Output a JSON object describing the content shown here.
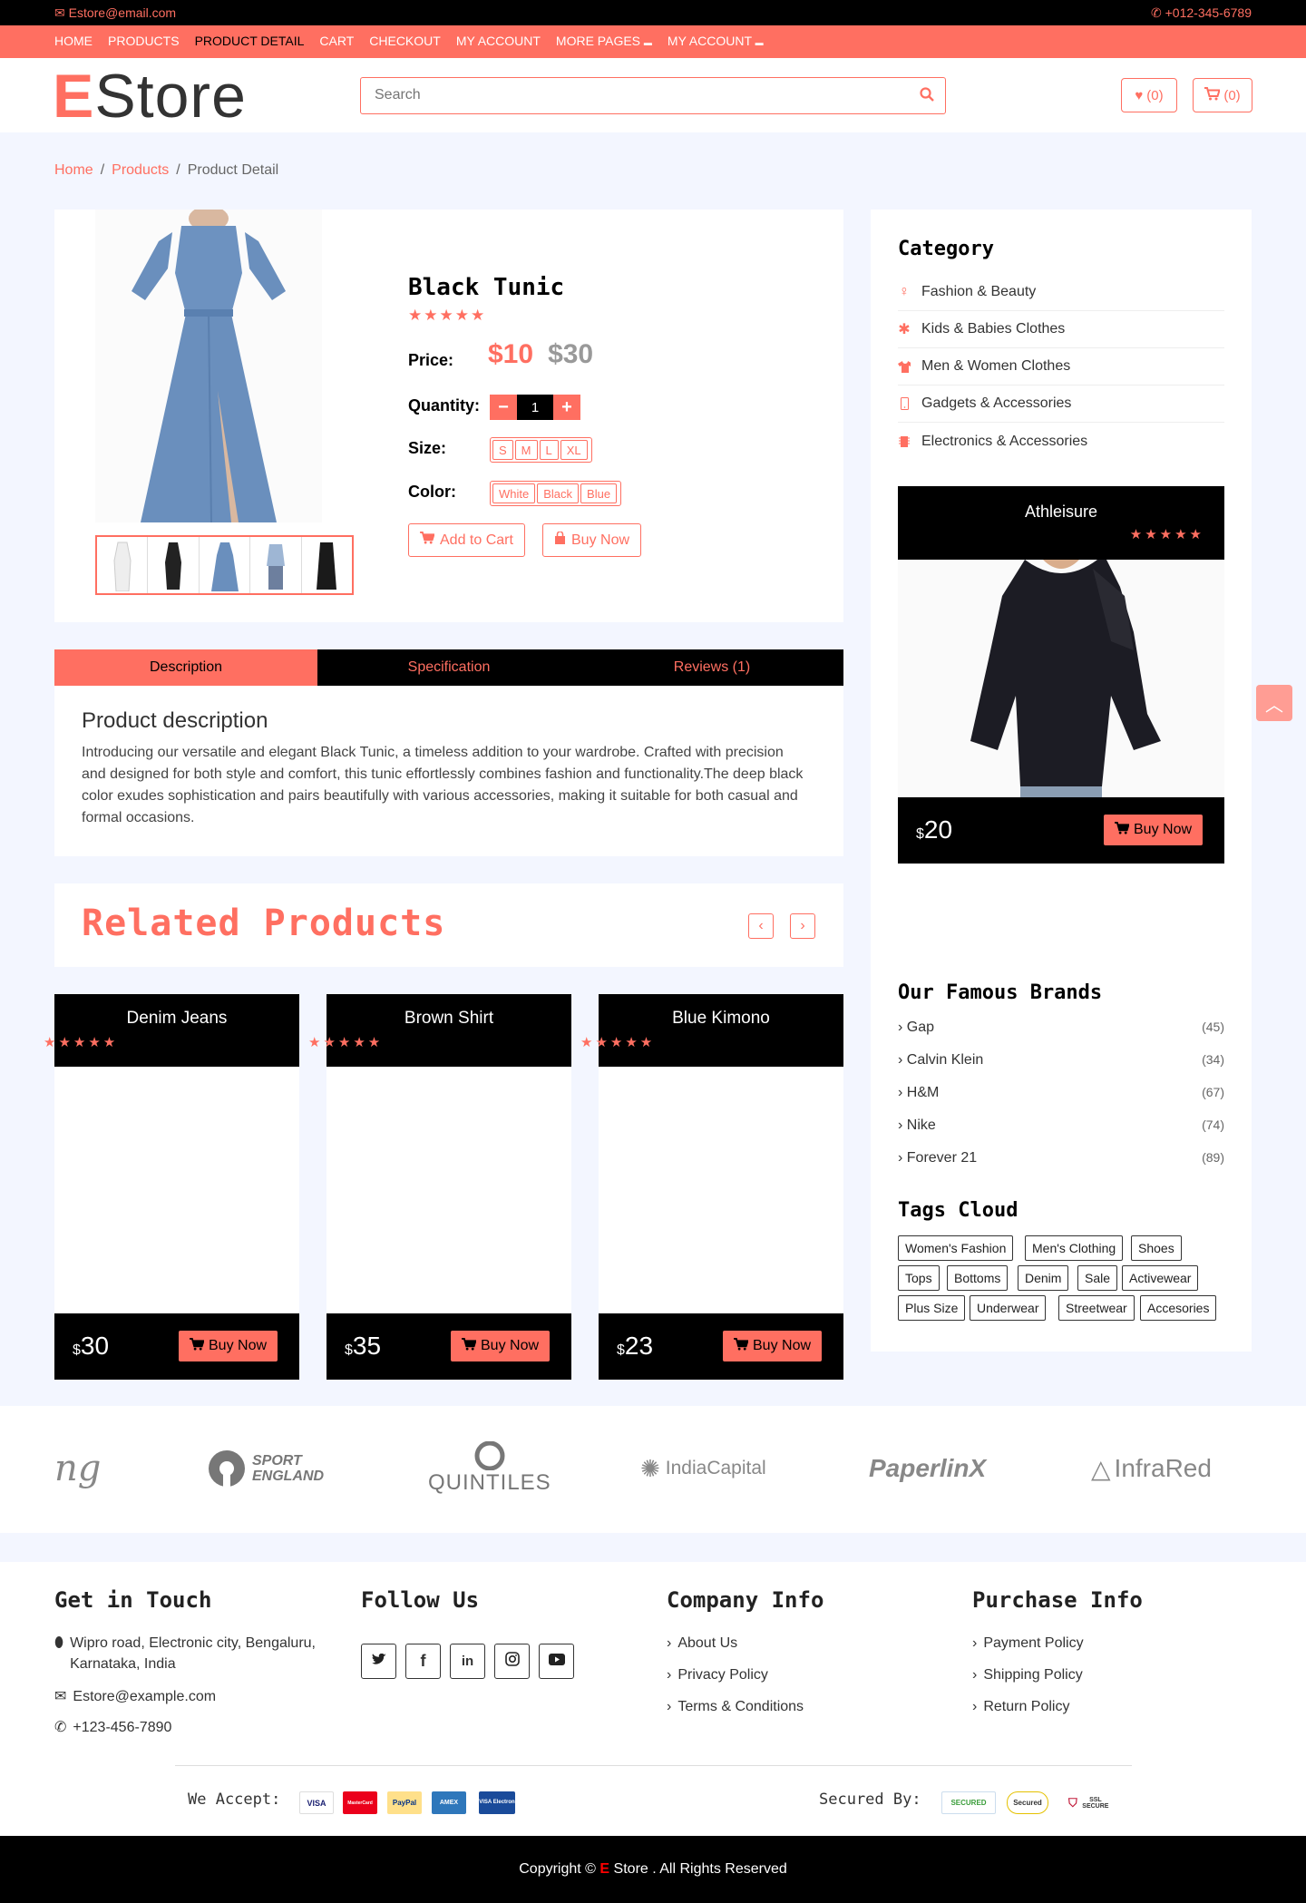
{
  "topbar": {
    "email": "Estore@email.com",
    "phone": "+012-345-6789"
  },
  "nav": [
    "HOME",
    "PRODUCTS",
    "PRODUCT DETAIL",
    "CART",
    "CHECKOUT",
    "MY ACCOUNT",
    "MORE PAGES",
    "MY ACCOUNT"
  ],
  "header": {
    "logo_initial": "E",
    "logo_rest": "Store",
    "search_placeholder": "Search",
    "wishlist_count": "(0)",
    "cart_count": "(0)"
  },
  "breadcrumb": {
    "home": "Home",
    "products": "Products",
    "current": "Product Detail"
  },
  "product": {
    "name": "Black Tunic",
    "stars": "★★★★★",
    "price_label": "Price:",
    "price": "$10",
    "old_price": "$30",
    "quantity_label": "Quantity:",
    "quantity": "1",
    "size_label": "Size:",
    "sizes": [
      "S",
      "M",
      "L",
      "XL"
    ],
    "color_label": "Color:",
    "colors": [
      "White",
      "Black",
      "Blue"
    ],
    "add_to_cart": "Add to Cart",
    "buy_now": "Buy Now"
  },
  "tabs": [
    "Description",
    "Specification",
    "Reviews (1)"
  ],
  "description": {
    "title": "Product description",
    "text": "Introducing our versatile and elegant Black Tunic, a timeless addition to your wardrobe. Crafted with precision and designed for both style and comfort, this tunic effortlessly combines fashion and functionality.The deep black color exudes sophistication and pairs beautifully with various accessories, making it suitable for both casual and formal occasions."
  },
  "related": {
    "title": "Related Products",
    "items": [
      {
        "name": "Denim Jeans",
        "currency": "$",
        "price": "30",
        "buy": "Buy Now",
        "stars": "★★★★★"
      },
      {
        "name": "Brown Shirt",
        "currency": "$",
        "price": "35",
        "buy": "Buy Now",
        "stars": "★★★★★"
      },
      {
        "name": "Blue Kimono",
        "currency": "$",
        "price": "23",
        "buy": "Buy Now",
        "stars": "★★★★★"
      }
    ]
  },
  "sidebar": {
    "category_title": "Category",
    "categories": [
      "Fashion & Beauty",
      "Kids & Babies Clothes",
      "Men & Women Clothes",
      "Gadgets & Accessories",
      "Electronics & Accessories"
    ],
    "featured": {
      "name": "Athleisure",
      "stars": "★★★★★",
      "currency": "$",
      "price": "20",
      "buy": "Buy Now"
    },
    "brands_title": "Our Famous Brands",
    "brands": [
      {
        "name": "Gap",
        "count": "(45)"
      },
      {
        "name": "Calvin Klein",
        "count": "(34)"
      },
      {
        "name": "H&M",
        "count": "(67)"
      },
      {
        "name": "Nike",
        "count": "(74)"
      },
      {
        "name": "Forever 21",
        "count": "(89)"
      }
    ],
    "tags_title": "Tags Cloud",
    "tags": [
      "Women's Fashion",
      "Men's Clothing",
      "Shoes",
      "Tops",
      "Bottoms",
      "Denim",
      "Sale",
      "Activewear",
      "Plus Size",
      "Underwear",
      "Streetwear",
      "Accesories"
    ]
  },
  "brand_logos": [
    "ng",
    "SPORT",
    "ENGLAND",
    "QUINTILES",
    "IndiaCapital",
    "PaperlinX",
    "InfraRed"
  ],
  "footer": {
    "touch_title": "Get in Touch",
    "address": "Wipro road, Electronic city, Bengaluru, Karnataka, India",
    "email": "Estore@example.com",
    "phone": "+123-456-7890",
    "follow_title": "Follow Us",
    "company_title": "Company Info",
    "company_links": [
      "About Us",
      "Privacy Policy",
      "Terms & Conditions"
    ],
    "purchase_title": "Purchase Info",
    "purchase_links": [
      "Payment Policy",
      "Shipping Policy",
      "Return Policy"
    ],
    "accept_label": "We Accept:",
    "cards": [
      "VISA",
      "MasterCard",
      "PayPal",
      "AMEX",
      "VISA Electron"
    ],
    "secured_label": "Secured By:",
    "secured_badges": [
      "SECURED",
      "Secured",
      "SSL SECURE"
    ],
    "copyright_prefix": "Copyright ©",
    "copyright_brand": "E",
    "copyright_suffix": "Store . All Rights Reserved"
  },
  "colors": {
    "accent": "#ff6f61",
    "dark": "#000000",
    "page_bg": "#f3f6ff"
  }
}
